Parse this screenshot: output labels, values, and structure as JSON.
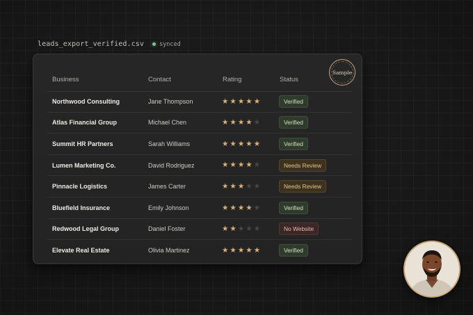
{
  "file": {
    "name": "leads_export_verified.csv",
    "sync_status": "synced"
  },
  "seal": {
    "label": "Sample"
  },
  "table": {
    "headers": {
      "business": "Business",
      "contact": "Contact",
      "rating": "Rating",
      "status": "Status"
    },
    "rows": [
      {
        "business": "Northwood Consulting",
        "contact": "Jane Thompson",
        "rating": 5,
        "status": "Verified",
        "status_type": "verified"
      },
      {
        "business": "Atlas Financial Group",
        "contact": "Michael Chen",
        "rating": 4,
        "status": "Verified",
        "status_type": "verified"
      },
      {
        "business": "Summit HR Partners",
        "contact": "Sarah Williams",
        "rating": 5,
        "status": "Verified",
        "status_type": "verified"
      },
      {
        "business": "Lumen Marketing Co.",
        "contact": "David Rodriguez",
        "rating": 4,
        "status": "Needs Review",
        "status_type": "review"
      },
      {
        "business": "Pinnacle Logistics",
        "contact": "James Carter",
        "rating": 3,
        "status": "Needs Review",
        "status_type": "review"
      },
      {
        "business": "Bluefield Insurance",
        "contact": "Emily Johnson",
        "rating": 4,
        "status": "Verified",
        "status_type": "verified"
      },
      {
        "business": "Redwood Legal Group",
        "contact": "Daniel Foster",
        "rating": 2,
        "status": "No Website",
        "status_type": "nowebsite"
      },
      {
        "business": "Elevate Real Estate",
        "contact": "Olivia Martinez",
        "rating": 5,
        "status": "Verified",
        "status_type": "verified"
      }
    ],
    "rating_max": 5
  },
  "colors": {
    "star_on": "#d9b27a",
    "star_off": "#4a4846",
    "verified": "#2f3b2c",
    "needs_review": "#3d3220",
    "no_website": "#3c2727",
    "accent_gold": "#c9a676",
    "sync_dot": "#7fc48a"
  },
  "icons": {
    "star": "star-icon",
    "sync": "sync-dot-icon",
    "seal": "seal-badge"
  }
}
